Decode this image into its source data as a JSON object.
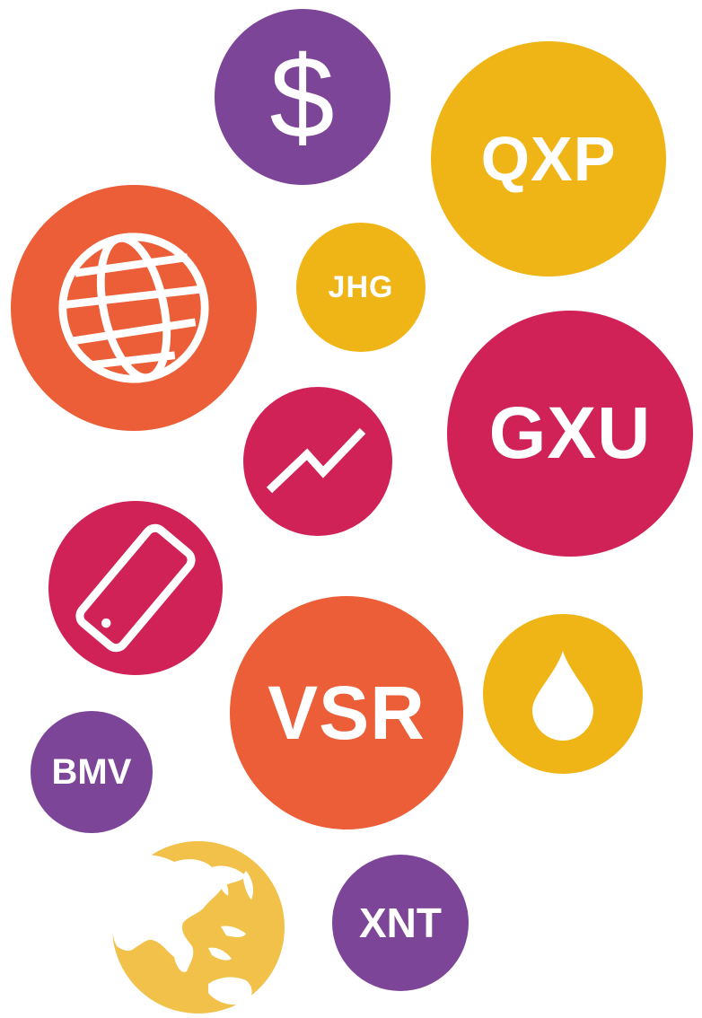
{
  "colors": {
    "purple": "#7d4598",
    "gold": "#efb416",
    "orange": "#ec5e37",
    "magenta": "#d02257",
    "earth_gold": "#f2c14a",
    "white": "#ffffff"
  },
  "bubbles": {
    "dollar": {
      "icon": "dollar-sign-icon",
      "glyph": "$"
    },
    "qxp": {
      "label": "QXP"
    },
    "globe": {
      "icon": "globe-icon"
    },
    "jhg": {
      "label": "JHG"
    },
    "gxu": {
      "label": "GXU"
    },
    "trend": {
      "icon": "trend-up-icon"
    },
    "phone": {
      "icon": "smartphone-icon"
    },
    "vsr": {
      "label": "VSR"
    },
    "drop": {
      "icon": "oil-drop-icon"
    },
    "bmv": {
      "label": "BMV"
    },
    "earth": {
      "icon": "earth-asia-icon"
    },
    "xnt": {
      "label": "XNT"
    }
  }
}
